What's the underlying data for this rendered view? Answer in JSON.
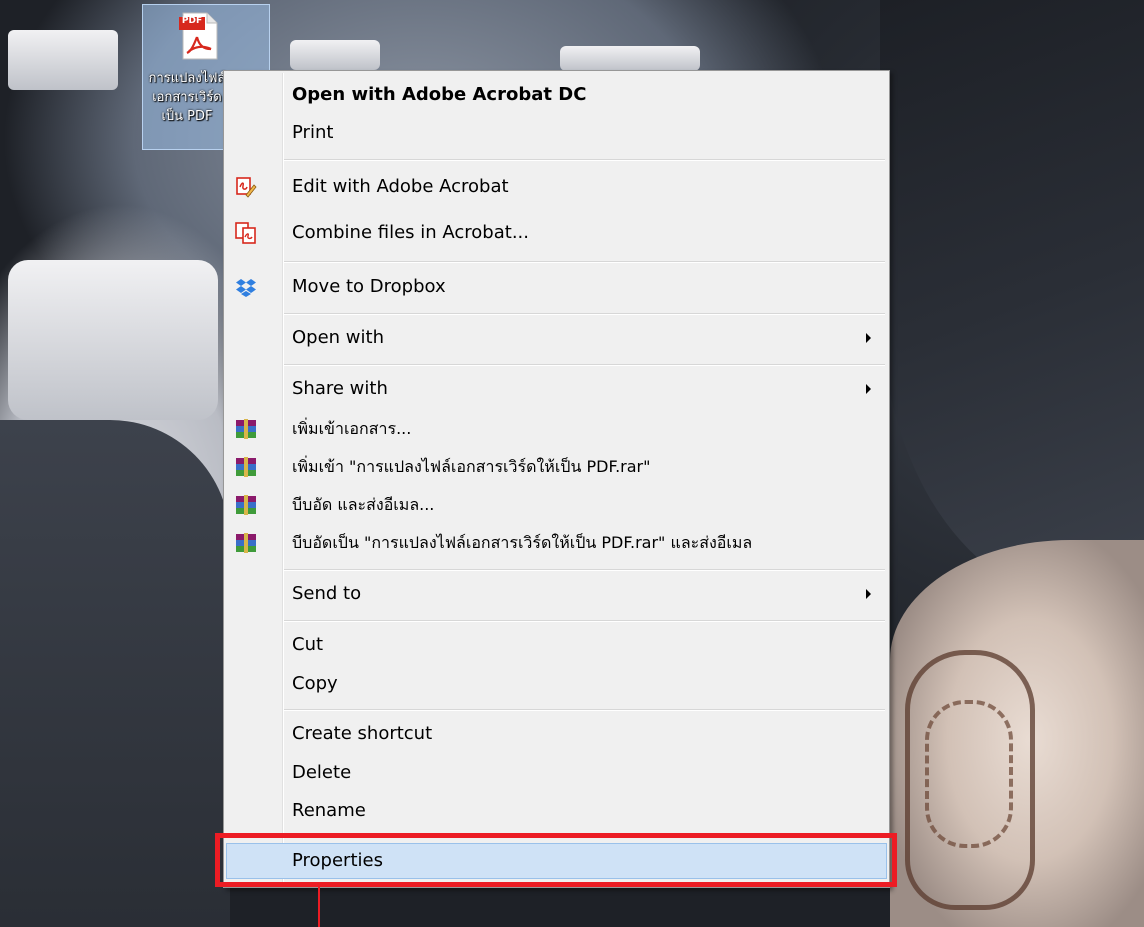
{
  "desktop_icon": {
    "badge": "PDF",
    "label_lines": [
      "การแปลงไฟล์",
      "เอกสารเวิร์ด",
      "เป็น PDF"
    ]
  },
  "context_menu": {
    "items": [
      {
        "label": "Open with Adobe Acrobat DC",
        "bold": true
      },
      {
        "label": "Print"
      },
      {
        "label": "Edit with Adobe Acrobat",
        "icon": "acrobat-edit-icon"
      },
      {
        "label": "Combine files in Acrobat...",
        "icon": "acrobat-combine-icon"
      },
      {
        "label": "Move to Dropbox",
        "icon": "dropbox-icon"
      },
      {
        "label": "Open with",
        "submenu": true
      },
      {
        "label": "Share with",
        "submenu": true
      },
      {
        "label": "เพิ่มเข้าเอกสาร...",
        "icon": "winrar-icon"
      },
      {
        "label": "เพิ่มเข้า \"การแปลงไฟล์เอกสารเวิร์ดให้เป็น PDF.rar\"",
        "icon": "winrar-icon"
      },
      {
        "label": "บีบอัด และส่งอีเมล...",
        "icon": "winrar-icon"
      },
      {
        "label": "บีบอัดเป็น \"การแปลงไฟล์เอกสารเวิร์ดให้เป็น PDF.rar\" และส่งอีเมล",
        "icon": "winrar-icon"
      },
      {
        "label": "Send to",
        "submenu": true
      },
      {
        "label": "Cut"
      },
      {
        "label": "Copy"
      },
      {
        "label": "Create shortcut"
      },
      {
        "label": "Delete"
      },
      {
        "label": "Rename"
      },
      {
        "label": "Properties",
        "highlighted": true
      }
    ]
  },
  "colors": {
    "menu_background": "#f0f0f0",
    "highlight": "#cfe2f6",
    "annotation": "#ec1c24",
    "winrar": "#8b1a6b",
    "dropbox": "#2f7fe0",
    "acrobat": "#d7281d"
  }
}
